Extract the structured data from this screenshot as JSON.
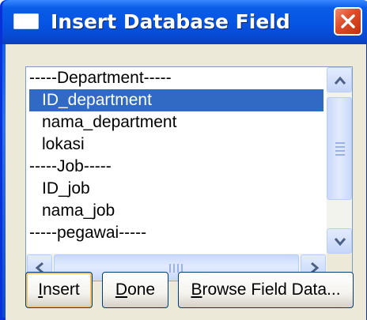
{
  "window": {
    "title": "Insert Database Field",
    "icons": {
      "app": "window-icon",
      "close": "close-icon"
    }
  },
  "list": {
    "items": [
      {
        "text": "-----Department-----",
        "kind": "header",
        "selected": false
      },
      {
        "text": "ID_department",
        "kind": "field",
        "selected": true
      },
      {
        "text": "nama_department",
        "kind": "field",
        "selected": false
      },
      {
        "text": "lokasi",
        "kind": "field",
        "selected": false
      },
      {
        "text": "-----Job-----",
        "kind": "header",
        "selected": false
      },
      {
        "text": "ID_job",
        "kind": "field",
        "selected": false
      },
      {
        "text": "nama_job",
        "kind": "field",
        "selected": false
      },
      {
        "text": "-----pegawai-----",
        "kind": "header",
        "selected": false
      }
    ]
  },
  "buttons": {
    "insert": {
      "mnemonic": "I",
      "rest": "nsert"
    },
    "done": {
      "mnemonic": "D",
      "rest": "one"
    },
    "browse": {
      "mnemonic": "B",
      "rest": "rowse Field Data..."
    }
  },
  "colors": {
    "titlebar": "#0654e3",
    "selection": "#316ac5",
    "close": "#dd4b27",
    "client": "#ece9d8"
  }
}
